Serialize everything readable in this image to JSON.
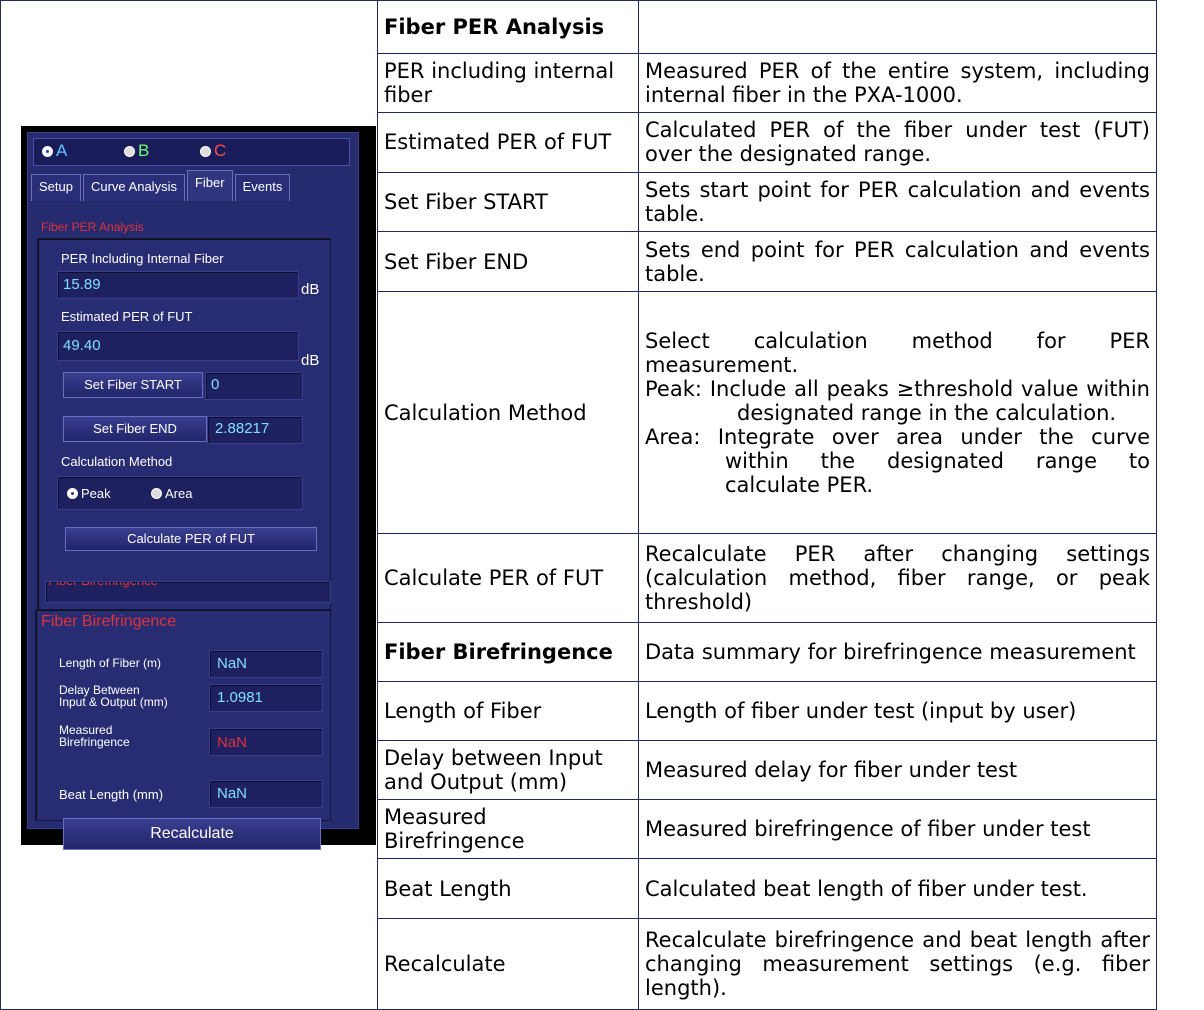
{
  "app": {
    "radios": [
      {
        "label": "A",
        "color": "#5bc8ff",
        "selected": true
      },
      {
        "label": "B",
        "color": "#6cff6c",
        "selected": false
      },
      {
        "label": "C",
        "color": "#ff4a4a",
        "selected": false
      }
    ],
    "tabs": [
      "Setup",
      "Curve Analysis",
      "Fiber",
      "Events"
    ],
    "active_tab": "Fiber",
    "per_section": {
      "title": "Fiber PER Analysis",
      "per_internal_label": "PER Including  Internal Fiber",
      "per_internal_value": "15.89",
      "unit": "dB",
      "est_per_label": "Estimated PER of FUT",
      "est_per_value": "49.40",
      "set_start_button": "Set Fiber START",
      "start_value": "0",
      "set_end_button": "Set Fiber END",
      "end_value": "2.88217",
      "method_label": "Calculation Method",
      "method_options": [
        "Peak",
        "Area"
      ],
      "method_selected": "Peak",
      "calc_button": "Calculate  PER of  FUT"
    },
    "bire_section": {
      "title": "Fiber Birefringence",
      "length_label": "Length of Fiber (m)",
      "length_value": "NaN",
      "delay_label_1": "Delay  Between",
      "delay_label_2": "Input & Output (mm)",
      "delay_value": "1.0981",
      "measured_label_1": "Measured",
      "measured_label_2": "Birefringence",
      "measured_value": "NaN",
      "beat_label": "Beat Length (mm)",
      "beat_value": "NaN",
      "recalc_button": "Recalculate"
    }
  },
  "table": {
    "header": "Fiber PER Analysis",
    "rows": [
      {
        "name": "PER including internal fiber",
        "desc": "Measured PER of the entire system, including internal fiber in the PXA-1000."
      },
      {
        "name": "Estimated PER of FUT",
        "desc": "Calculated PER of the fiber under test (FUT) over the designated range."
      },
      {
        "name": "Set Fiber START",
        "desc": "Sets start point for PER calculation and events table."
      },
      {
        "name": "Set Fiber END",
        "desc": "Sets end point for PER calculation and events table."
      },
      {
        "name": "Calculation Method",
        "desc_intro": "Select calculation method for PER measurement.",
        "desc_peak": "Peak: Include all peaks ≥threshold value within designated range in the calculation.",
        "desc_area": "Area: Integrate over area under the curve within the designated range to calculate PER."
      },
      {
        "name": "Calculate PER of FUT",
        "desc": "Recalculate PER after changing settings (calculation method, fiber range, or peak threshold)"
      },
      {
        "name": "Fiber Birefringence",
        "desc": "Data summary for birefringence measurement"
      },
      {
        "name": "Length of Fiber",
        "desc": "Length of fiber under test (input by user)"
      },
      {
        "name": "Delay between Input and Output (mm)",
        "desc": "Measured delay for fiber under test"
      },
      {
        "name": "Measured Birefringence",
        "desc": "Measured birefringence of fiber under test"
      },
      {
        "name": "Beat Length",
        "desc": "Calculated beat length of fiber under test."
      },
      {
        "name": "Recalculate",
        "desc": "Recalculate birefringence and beat length after changing measurement settings (e.g. fiber length)."
      }
    ]
  }
}
